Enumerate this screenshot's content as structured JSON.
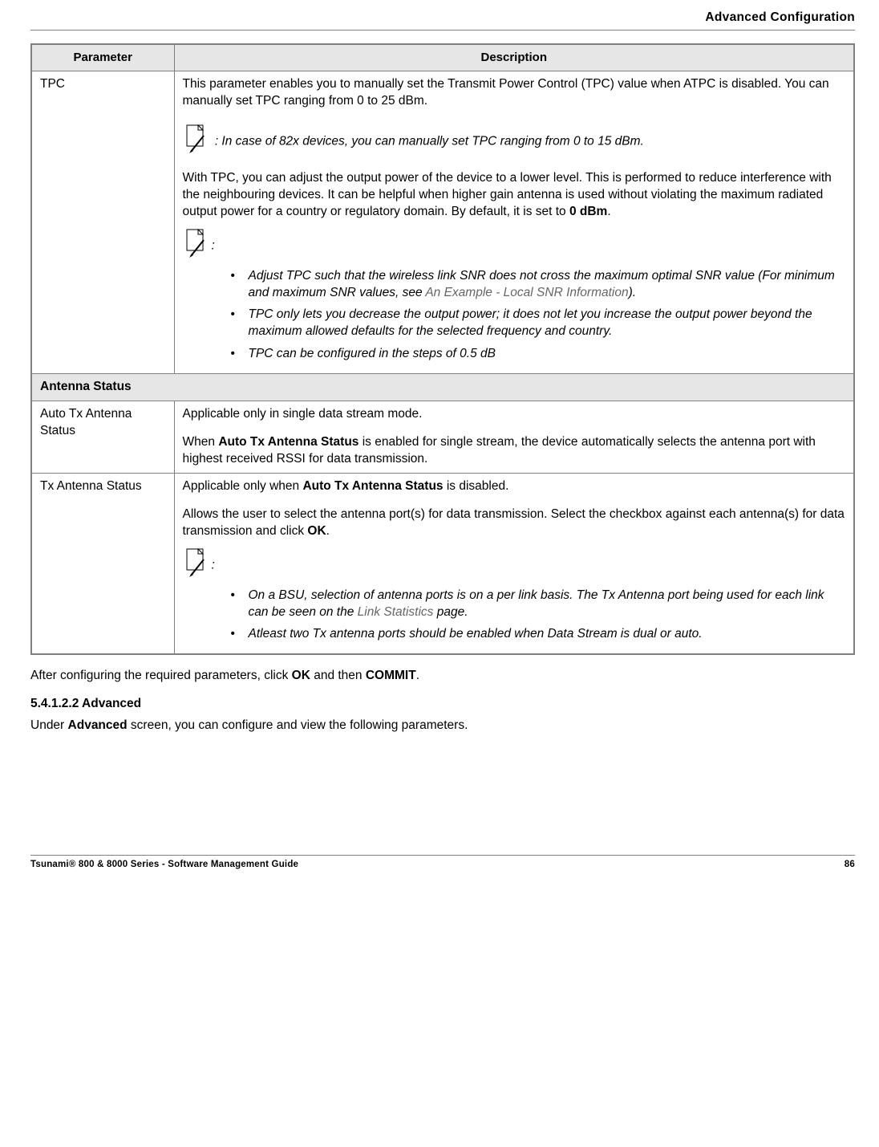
{
  "header": {
    "chapterTitle": "Advanced Configuration"
  },
  "table": {
    "parameterHeader": "Parameter",
    "descriptionHeader": "Description",
    "rows": {
      "tpc": {
        "param": "TPC",
        "intro": "This parameter enables you to manually set the Transmit Power Control (TPC) value when ATPC is disabled. You can manually set TPC ranging from 0 to 25 dBm.",
        "note82x": ": In case of 82x devices, you can manually set TPC ranging from 0 to 15 dBm.",
        "body1": "With TPC, you can adjust the output power of the device to a lower level. This is performed to reduce interference with the neighbouring devices. It can be helpful when higher gain antenna is used without violating the maximum radiated output power for a country or regulatory domain. By default, it is set to ",
        "default": "0 dBm",
        "bodyTail": ".",
        "colon": ":",
        "bullets": {
          "b1a": "Adjust TPC such that the wireless link SNR does not cross the maximum optimal SNR value (For minimum and maximum SNR values, see ",
          "b1link": "An Example - Local SNR Information",
          "b1b": ").",
          "b2": "TPC only lets you decrease the output power; it does not let you increase the output power beyond the maximum allowed defaults for the selected frequency and country.",
          "b3": "TPC can be configured in the steps of 0.5 dB"
        }
      },
      "antennaSection": "Antenna Status",
      "autoTx": {
        "param": "Auto Tx Antenna Status",
        "line1": "Applicable only in single data stream mode.",
        "line2a": "When ",
        "line2b": "Auto Tx Antenna Status",
        "line2c": " is enabled for single stream, the device automatically selects the antenna port with highest received RSSI for data transmission."
      },
      "txAnt": {
        "param": "Tx Antenna Status",
        "line1a": "Applicable only when ",
        "line1b": "Auto Tx Antenna Status",
        "line1c": " is disabled.",
        "line2a": "Allows the user to select the antenna port(s) for data transmission. Select the checkbox against each antenna(s) for data transmission and click ",
        "ok": "OK",
        "period": ".",
        "colon": ":",
        "bullets": {
          "b1a": "On a BSU, selection of antenna ports is on a per link basis. The Tx Antenna port being used for each link can be seen on the ",
          "b1link": "Link Statistics",
          "b1b": " page.",
          "b2": "Atleast two Tx antenna ports should be enabled when Data Stream is dual or auto."
        }
      }
    }
  },
  "after": {
    "text1a": "After configuring the required parameters, click ",
    "ok": "OK",
    "text1b": " and then ",
    "commit": "COMMIT",
    "text1c": ".",
    "subheading": "5.4.1.2.2 Advanced",
    "subbody1a": "Under ",
    "subbody1b": "Advanced",
    "subbody1c": " screen, you can configure and view the following parameters."
  },
  "footer": {
    "left": "Tsunami® 800 & 8000 Series - Software Management Guide",
    "right": "86"
  }
}
